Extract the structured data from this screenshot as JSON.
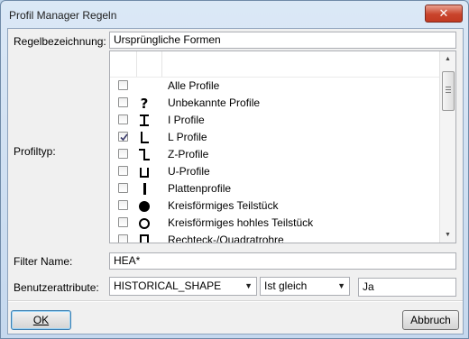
{
  "window": {
    "title": "Profil Manager Regeln",
    "close_symbol": "✕"
  },
  "labels": {
    "rule_name": "Regelbezeichnung:",
    "profile_type": "Profiltyp:",
    "filter_name": "Filter Name:",
    "user_attributes": "Benutzerattribute:"
  },
  "fields": {
    "rule_name_value": "Ursprüngliche Formen",
    "filter_name_value": "HEA*",
    "attribute_name": "HISTORICAL_SHAPE",
    "operator": "Ist gleich",
    "attribute_value": "Ja"
  },
  "profile_list": [
    {
      "label": "Alle Profile",
      "checked": false,
      "icon": "none-icon"
    },
    {
      "label": "Unbekannte Profile",
      "checked": false,
      "icon": "question-mark-icon"
    },
    {
      "label": "I Profile",
      "checked": false,
      "icon": "i-profile-icon"
    },
    {
      "label": "L Profile",
      "checked": true,
      "icon": "l-profile-icon"
    },
    {
      "label": "Z-Profile",
      "checked": false,
      "icon": "z-profile-icon"
    },
    {
      "label": "U-Profile",
      "checked": false,
      "icon": "u-profile-icon"
    },
    {
      "label": "Plattenprofile",
      "checked": false,
      "icon": "plate-profile-icon"
    },
    {
      "label": "Kreisförmiges Teilstück",
      "checked": false,
      "icon": "filled-circle-icon"
    },
    {
      "label": "Kreisförmiges hohles Teilstück",
      "checked": false,
      "icon": "hollow-circle-icon"
    },
    {
      "label": "Rechteck-/Quadratrohre",
      "checked": false,
      "icon": "rectangle-tube-icon"
    }
  ],
  "buttons": {
    "ok": "OK",
    "cancel": "Abbruch"
  }
}
